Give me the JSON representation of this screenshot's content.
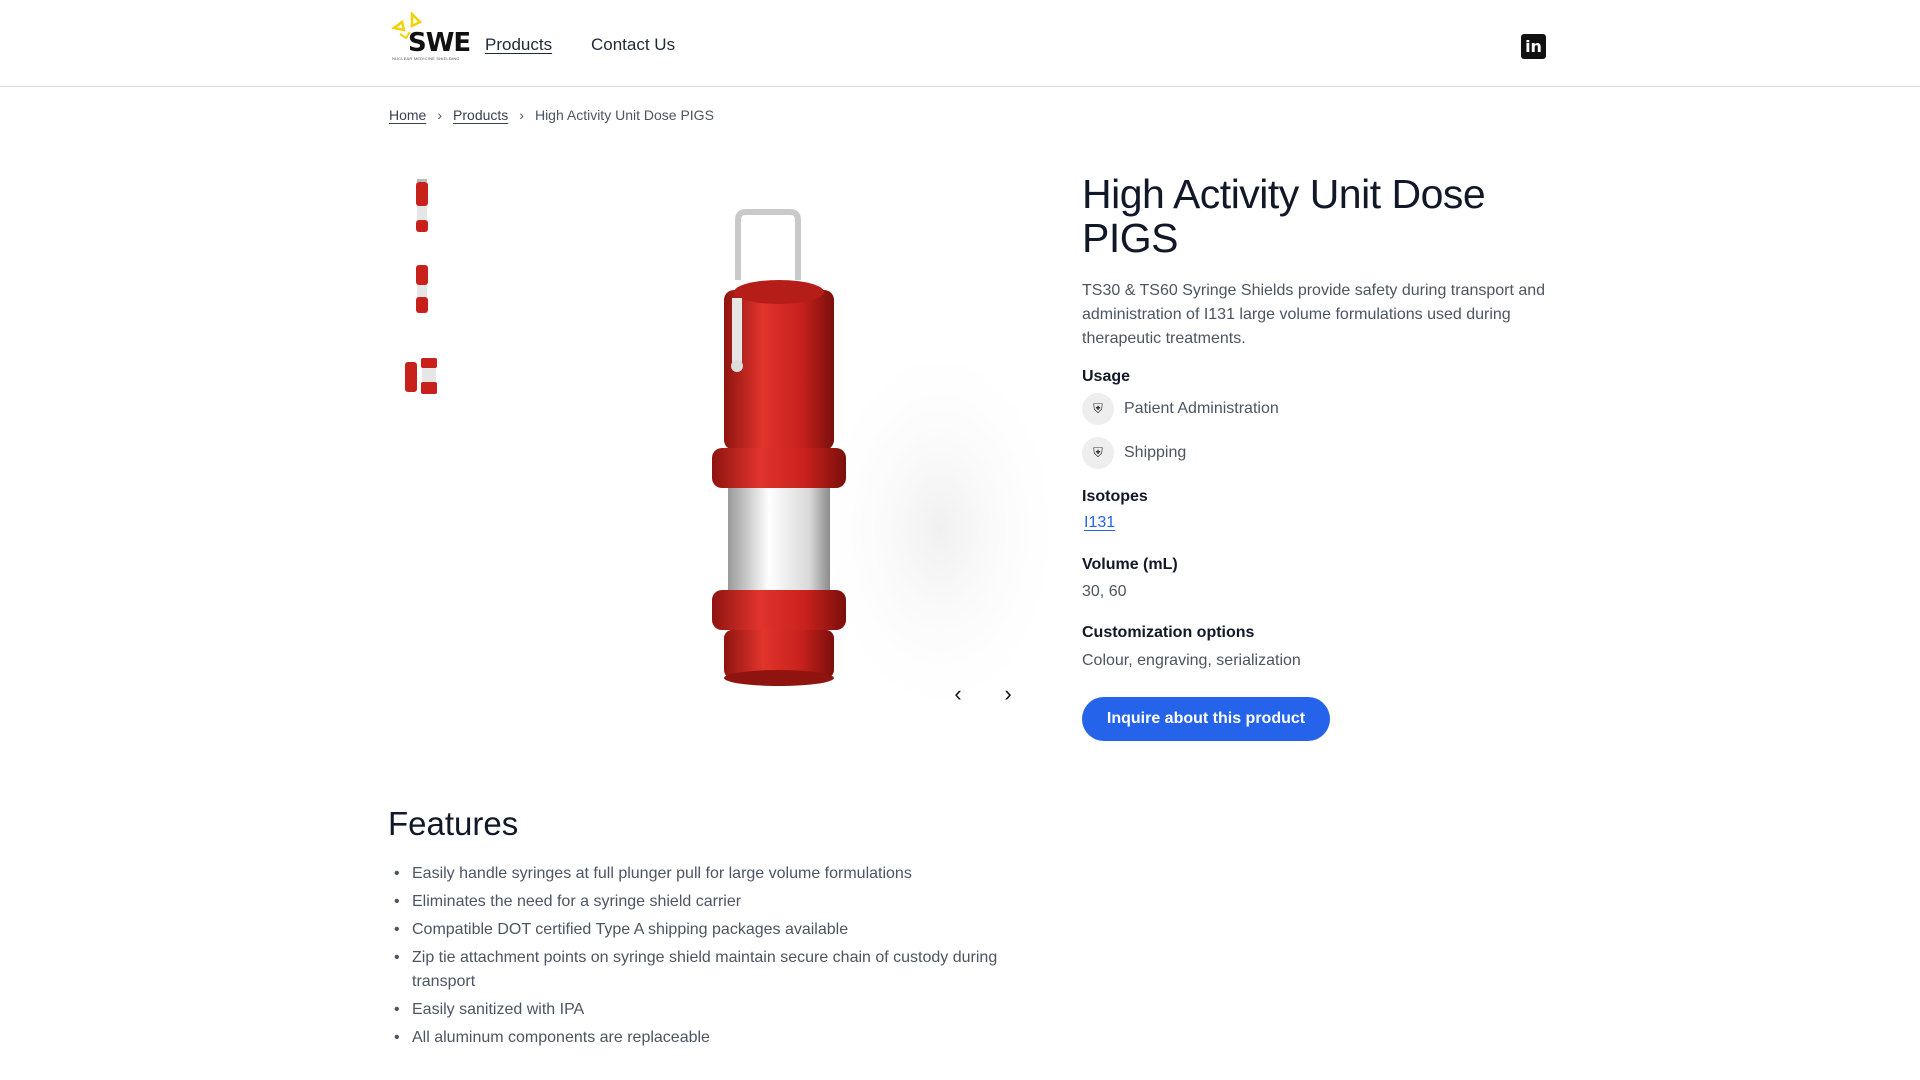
{
  "header": {
    "logo_text": "SWE",
    "logo_subtext": "NUCLEAR MEDICINE SHIELDING",
    "nav": [
      {
        "label": "Products"
      },
      {
        "label": "Contact Us"
      }
    ],
    "linkedin_label": "in"
  },
  "breadcrumb": {
    "items": [
      "Home",
      "Products"
    ],
    "current": "High Activity Unit Dose PIGS"
  },
  "gallery": {
    "thumbnails": [
      "thumbnail-1",
      "thumbnail-2",
      "thumbnail-3"
    ],
    "prev_icon": "chevron-left-icon",
    "next_icon": "chevron-right-icon"
  },
  "product": {
    "title": "High Activity Unit Dose PIGS",
    "description": "TS30 & TS60 Syringe Shields provide safety during transport and administration of I131 large volume formulations used during therapeutic treatments.",
    "usage_label": "Usage",
    "usage": [
      "Patient Administration",
      "Shipping"
    ],
    "isotopes_label": "Isotopes",
    "isotopes": [
      "I131"
    ],
    "volume_label": "Volume (mL)",
    "volume": "30, 60",
    "customization_label": "Customization options",
    "customization": "Colour, engraving, serialization",
    "cta": "Inquire about this product"
  },
  "features": {
    "title": "Features",
    "items": [
      "Easily handle syringes at full plunger pull for large volume formulations",
      "Eliminates the need for a syringe shield carrier",
      "Compatible DOT certified Type A shipping packages available",
      "Zip tie attachment points on syringe shield maintain secure chain of custody during transport",
      "Easily sanitized with IPA",
      "All aluminum components are replaceable"
    ]
  },
  "colors": {
    "accent": "#2563eb",
    "product_red": "#c8211c",
    "logo_yellow": "#f5d000"
  }
}
